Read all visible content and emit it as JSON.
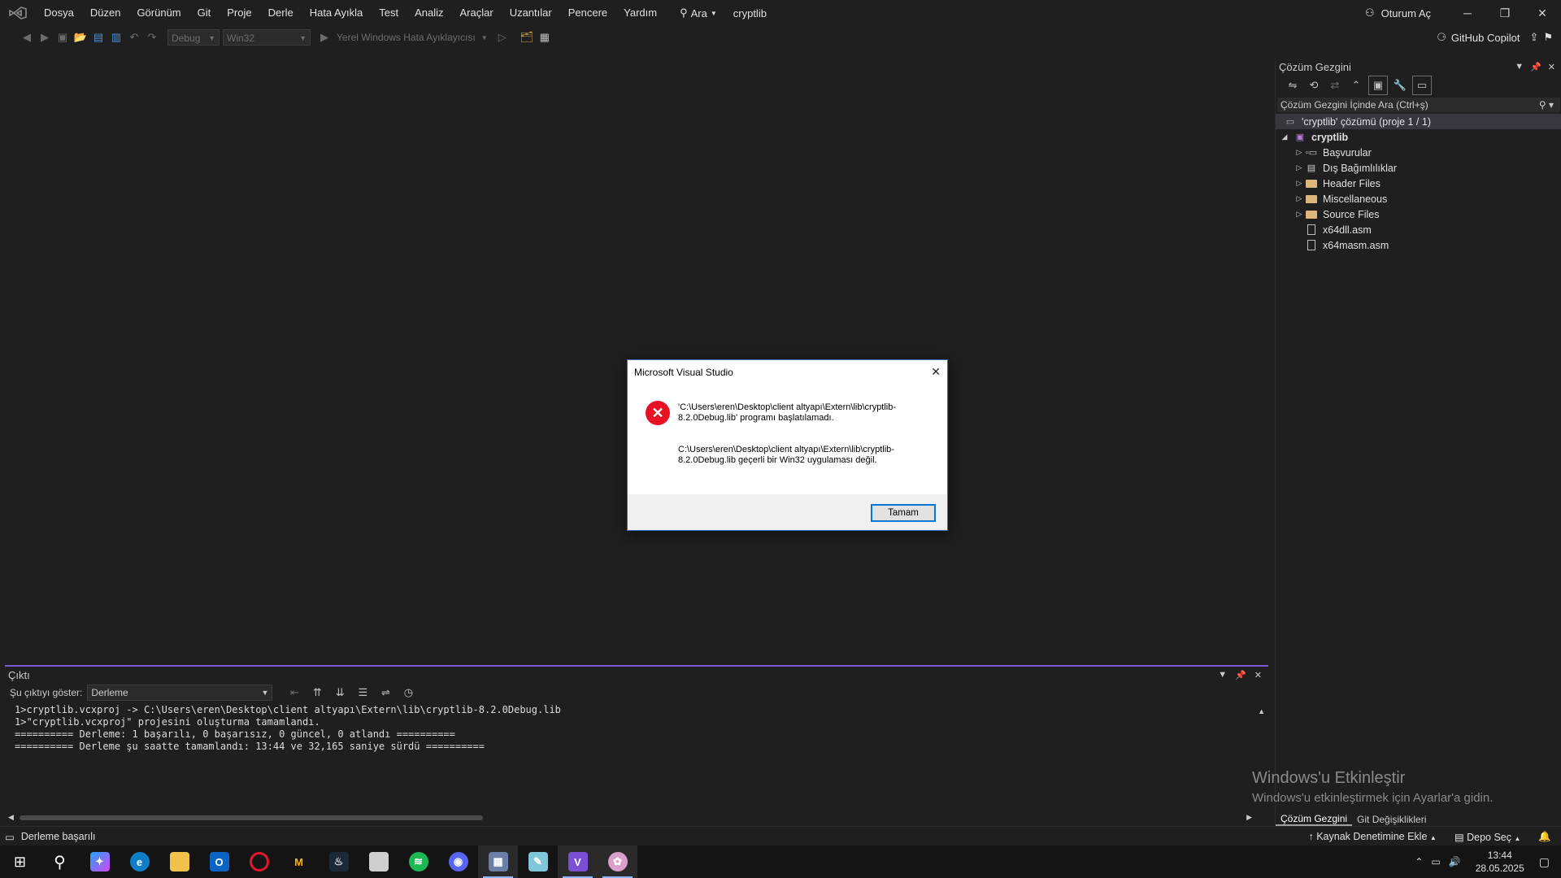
{
  "menubar": {
    "items": [
      "Dosya",
      "Düzen",
      "Görünüm",
      "Git",
      "Proje",
      "Derle",
      "Hata Ayıkla",
      "Test",
      "Analiz",
      "Araçlar",
      "Uzantılar",
      "Pencere",
      "Yardım"
    ],
    "search_label": "Ara",
    "solution_name": "cryptlib",
    "signin_label": "Oturum Aç"
  },
  "toolbar": {
    "config": "Debug",
    "platform": "Win32",
    "debugger": "Yerel Windows Hata Ayıklayıcısı",
    "copilot_label": "GitHub Copilot"
  },
  "solution_explorer": {
    "title": "Çözüm Gezgini",
    "search_placeholder": "Çözüm Gezgini İçinde Ara (Ctrl+ş)",
    "solution_label": "'cryptlib' çözümü (proje 1 / 1)",
    "project_label": "cryptlib",
    "items": [
      {
        "label": "Başvurular",
        "kind": "references",
        "expandable": true
      },
      {
        "label": "Dış Bağımlılıklar",
        "kind": "external",
        "expandable": true
      },
      {
        "label": "Header Files",
        "kind": "folder",
        "expandable": true
      },
      {
        "label": "Miscellaneous",
        "kind": "folder",
        "expandable": true
      },
      {
        "label": "Source Files",
        "kind": "folder",
        "expandable": true
      },
      {
        "label": "x64dll.asm",
        "kind": "file",
        "expandable": false
      },
      {
        "label": "x64masm.asm",
        "kind": "file",
        "expandable": false
      }
    ],
    "tabs": [
      "Çözüm Gezgini",
      "Git Değişiklikleri"
    ]
  },
  "output": {
    "title": "Çıktı",
    "show_label": "Şu çıktıyı göster:",
    "source": "Derleme",
    "lines": [
      "1>cryptlib.vcxproj -> C:\\Users\\eren\\Desktop\\client altyapı\\Extern\\lib\\cryptlib-8.2.0Debug.lib",
      "1>\"cryptlib.vcxproj\" projesini oluşturma tamamlandı.",
      "========== Derleme: 1 başarılı, 0 başarısız, 0 güncel, 0 atlandı ==========",
      "========== Derleme şu saatte tamamlandı: 13:44 ve 32,165 saniye sürdü =========="
    ]
  },
  "watermark": {
    "title": "Windows'u Etkinleştir",
    "subtitle": "Windows'u etkinleştirmek için Ayarlar'a gidin."
  },
  "status_bar": {
    "message": "Derleme başarılı",
    "source_control": "Kaynak Denetimine Ekle",
    "repo": "Depo Seç"
  },
  "dialog": {
    "title": "Microsoft Visual Studio",
    "message1": "'C:\\Users\\eren\\Desktop\\client altyapı\\Extern\\lib\\cryptlib-8.2.0Debug.lib' programı başlatılamadı.",
    "message2": "C:\\Users\\eren\\Desktop\\client altyapı\\Extern\\lib\\cryptlib-8.2.0Debug.lib geçerli bir Win32 uygulaması değil.",
    "ok_label": "Tamam"
  },
  "taskbar": {
    "apps": [
      "windows-start-icon",
      "search-icon",
      "copilot-icon",
      "edge-icon",
      "file-explorer-icon",
      "outlook-icon",
      "opera-icon",
      "gmail-icon",
      "steam-icon",
      "files-icon",
      "spotify-icon",
      "discord-icon",
      "app-icon",
      "notepad-icon",
      "visual-studio-icon",
      "paint-icon"
    ],
    "time": "13:44",
    "date": "28.05.2025"
  },
  "colors": {
    "accent": "#7c5dd1",
    "error": "#e81123",
    "background": "#1f1f1f"
  }
}
